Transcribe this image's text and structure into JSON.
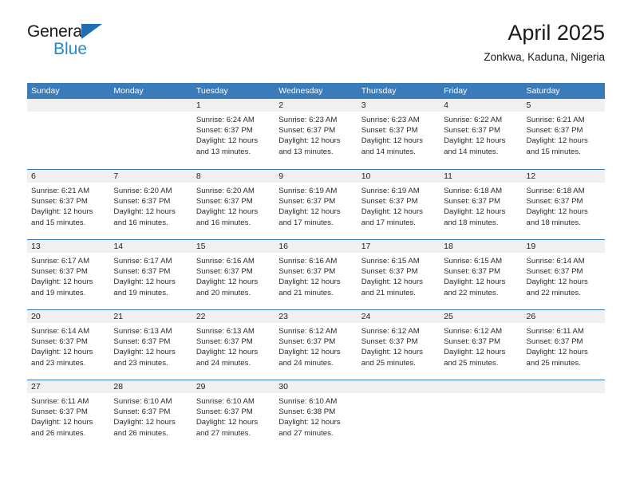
{
  "brand": {
    "name_part1": "General",
    "name_part2": "Blue",
    "logo_icon": "blue-triangle-icon"
  },
  "header": {
    "title": "April 2025",
    "subtitle": "Zonkwa, Kaduna, Nigeria"
  },
  "colors": {
    "header_blue": "#3a7cba",
    "brand_blue": "#2489ce",
    "daynum_band": "#f0f0f0",
    "text": "#222222"
  },
  "weekdays": [
    "Sunday",
    "Monday",
    "Tuesday",
    "Wednesday",
    "Thursday",
    "Friday",
    "Saturday"
  ],
  "weeks": [
    [
      {
        "day": "",
        "empty": true
      },
      {
        "day": "",
        "empty": true
      },
      {
        "day": "1",
        "sunrise": "Sunrise: 6:24 AM",
        "sunset": "Sunset: 6:37 PM",
        "daylight_line1": "Daylight: 12 hours",
        "daylight_line2": "and 13 minutes."
      },
      {
        "day": "2",
        "sunrise": "Sunrise: 6:23 AM",
        "sunset": "Sunset: 6:37 PM",
        "daylight_line1": "Daylight: 12 hours",
        "daylight_line2": "and 13 minutes."
      },
      {
        "day": "3",
        "sunrise": "Sunrise: 6:23 AM",
        "sunset": "Sunset: 6:37 PM",
        "daylight_line1": "Daylight: 12 hours",
        "daylight_line2": "and 14 minutes."
      },
      {
        "day": "4",
        "sunrise": "Sunrise: 6:22 AM",
        "sunset": "Sunset: 6:37 PM",
        "daylight_line1": "Daylight: 12 hours",
        "daylight_line2": "and 14 minutes."
      },
      {
        "day": "5",
        "sunrise": "Sunrise: 6:21 AM",
        "sunset": "Sunset: 6:37 PM",
        "daylight_line1": "Daylight: 12 hours",
        "daylight_line2": "and 15 minutes."
      }
    ],
    [
      {
        "day": "6",
        "sunrise": "Sunrise: 6:21 AM",
        "sunset": "Sunset: 6:37 PM",
        "daylight_line1": "Daylight: 12 hours",
        "daylight_line2": "and 15 minutes."
      },
      {
        "day": "7",
        "sunrise": "Sunrise: 6:20 AM",
        "sunset": "Sunset: 6:37 PM",
        "daylight_line1": "Daylight: 12 hours",
        "daylight_line2": "and 16 minutes."
      },
      {
        "day": "8",
        "sunrise": "Sunrise: 6:20 AM",
        "sunset": "Sunset: 6:37 PM",
        "daylight_line1": "Daylight: 12 hours",
        "daylight_line2": "and 16 minutes."
      },
      {
        "day": "9",
        "sunrise": "Sunrise: 6:19 AM",
        "sunset": "Sunset: 6:37 PM",
        "daylight_line1": "Daylight: 12 hours",
        "daylight_line2": "and 17 minutes."
      },
      {
        "day": "10",
        "sunrise": "Sunrise: 6:19 AM",
        "sunset": "Sunset: 6:37 PM",
        "daylight_line1": "Daylight: 12 hours",
        "daylight_line2": "and 17 minutes."
      },
      {
        "day": "11",
        "sunrise": "Sunrise: 6:18 AM",
        "sunset": "Sunset: 6:37 PM",
        "daylight_line1": "Daylight: 12 hours",
        "daylight_line2": "and 18 minutes."
      },
      {
        "day": "12",
        "sunrise": "Sunrise: 6:18 AM",
        "sunset": "Sunset: 6:37 PM",
        "daylight_line1": "Daylight: 12 hours",
        "daylight_line2": "and 18 minutes."
      }
    ],
    [
      {
        "day": "13",
        "sunrise": "Sunrise: 6:17 AM",
        "sunset": "Sunset: 6:37 PM",
        "daylight_line1": "Daylight: 12 hours",
        "daylight_line2": "and 19 minutes."
      },
      {
        "day": "14",
        "sunrise": "Sunrise: 6:17 AM",
        "sunset": "Sunset: 6:37 PM",
        "daylight_line1": "Daylight: 12 hours",
        "daylight_line2": "and 19 minutes."
      },
      {
        "day": "15",
        "sunrise": "Sunrise: 6:16 AM",
        "sunset": "Sunset: 6:37 PM",
        "daylight_line1": "Daylight: 12 hours",
        "daylight_line2": "and 20 minutes."
      },
      {
        "day": "16",
        "sunrise": "Sunrise: 6:16 AM",
        "sunset": "Sunset: 6:37 PM",
        "daylight_line1": "Daylight: 12 hours",
        "daylight_line2": "and 21 minutes."
      },
      {
        "day": "17",
        "sunrise": "Sunrise: 6:15 AM",
        "sunset": "Sunset: 6:37 PM",
        "daylight_line1": "Daylight: 12 hours",
        "daylight_line2": "and 21 minutes."
      },
      {
        "day": "18",
        "sunrise": "Sunrise: 6:15 AM",
        "sunset": "Sunset: 6:37 PM",
        "daylight_line1": "Daylight: 12 hours",
        "daylight_line2": "and 22 minutes."
      },
      {
        "day": "19",
        "sunrise": "Sunrise: 6:14 AM",
        "sunset": "Sunset: 6:37 PM",
        "daylight_line1": "Daylight: 12 hours",
        "daylight_line2": "and 22 minutes."
      }
    ],
    [
      {
        "day": "20",
        "sunrise": "Sunrise: 6:14 AM",
        "sunset": "Sunset: 6:37 PM",
        "daylight_line1": "Daylight: 12 hours",
        "daylight_line2": "and 23 minutes."
      },
      {
        "day": "21",
        "sunrise": "Sunrise: 6:13 AM",
        "sunset": "Sunset: 6:37 PM",
        "daylight_line1": "Daylight: 12 hours",
        "daylight_line2": "and 23 minutes."
      },
      {
        "day": "22",
        "sunrise": "Sunrise: 6:13 AM",
        "sunset": "Sunset: 6:37 PM",
        "daylight_line1": "Daylight: 12 hours",
        "daylight_line2": "and 24 minutes."
      },
      {
        "day": "23",
        "sunrise": "Sunrise: 6:12 AM",
        "sunset": "Sunset: 6:37 PM",
        "daylight_line1": "Daylight: 12 hours",
        "daylight_line2": "and 24 minutes."
      },
      {
        "day": "24",
        "sunrise": "Sunrise: 6:12 AM",
        "sunset": "Sunset: 6:37 PM",
        "daylight_line1": "Daylight: 12 hours",
        "daylight_line2": "and 25 minutes."
      },
      {
        "day": "25",
        "sunrise": "Sunrise: 6:12 AM",
        "sunset": "Sunset: 6:37 PM",
        "daylight_line1": "Daylight: 12 hours",
        "daylight_line2": "and 25 minutes."
      },
      {
        "day": "26",
        "sunrise": "Sunrise: 6:11 AM",
        "sunset": "Sunset: 6:37 PM",
        "daylight_line1": "Daylight: 12 hours",
        "daylight_line2": "and 25 minutes."
      }
    ],
    [
      {
        "day": "27",
        "sunrise": "Sunrise: 6:11 AM",
        "sunset": "Sunset: 6:37 PM",
        "daylight_line1": "Daylight: 12 hours",
        "daylight_line2": "and 26 minutes."
      },
      {
        "day": "28",
        "sunrise": "Sunrise: 6:10 AM",
        "sunset": "Sunset: 6:37 PM",
        "daylight_line1": "Daylight: 12 hours",
        "daylight_line2": "and 26 minutes."
      },
      {
        "day": "29",
        "sunrise": "Sunrise: 6:10 AM",
        "sunset": "Sunset: 6:37 PM",
        "daylight_line1": "Daylight: 12 hours",
        "daylight_line2": "and 27 minutes."
      },
      {
        "day": "30",
        "sunrise": "Sunrise: 6:10 AM",
        "sunset": "Sunset: 6:38 PM",
        "daylight_line1": "Daylight: 12 hours",
        "daylight_line2": "and 27 minutes."
      },
      {
        "day": "",
        "empty": true
      },
      {
        "day": "",
        "empty": true
      },
      {
        "day": "",
        "empty": true
      }
    ]
  ]
}
